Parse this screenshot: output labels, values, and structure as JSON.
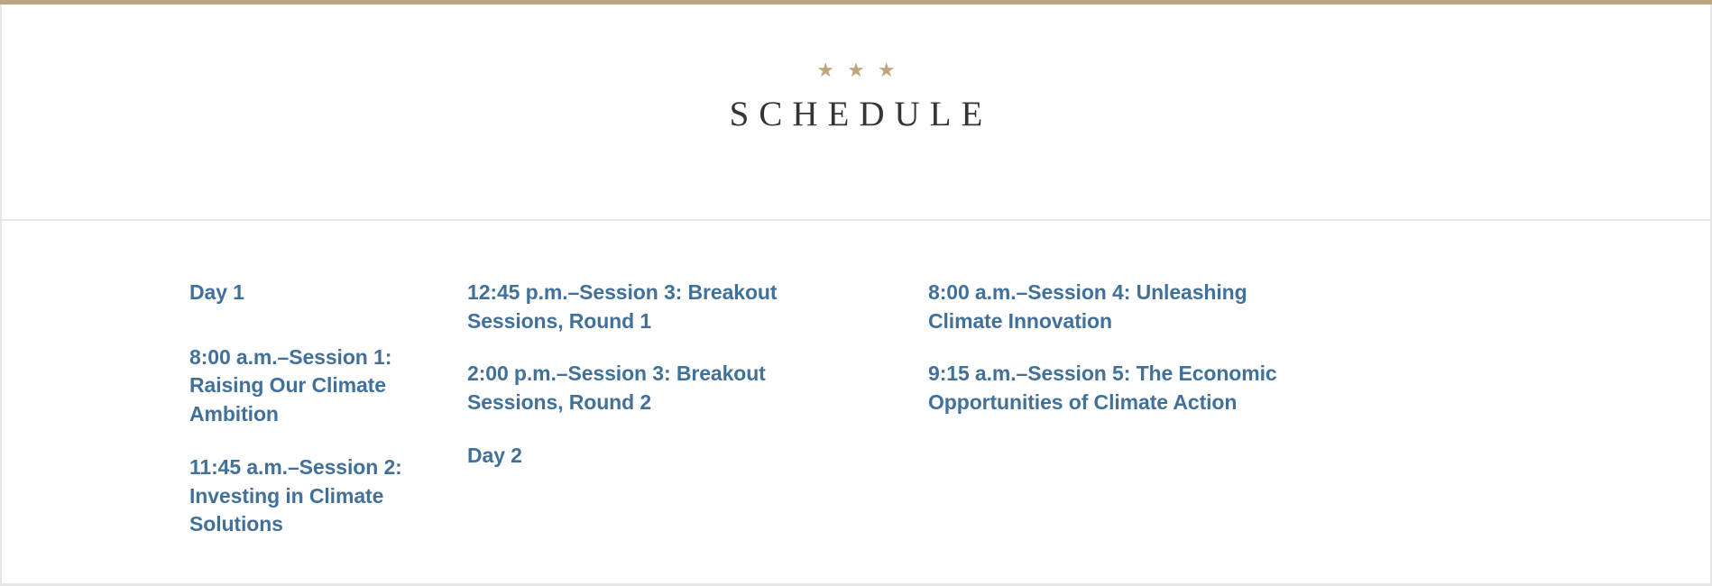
{
  "header": {
    "stars": [
      "★",
      "★",
      "★"
    ],
    "title": "SCHEDULE",
    "star_color": "#bfa57f",
    "title_color": "#33343a",
    "top_rule_color": "#bfa57f"
  },
  "theme": {
    "accent_blue": "#41719b",
    "border_gray": "#e6e6e8",
    "background": "#ffffff"
  },
  "columns": [
    {
      "id": "column-1",
      "items": [
        {
          "type": "day-heading",
          "text": "Day 1"
        },
        {
          "type": "session",
          "text": "8:00 a.m.–Session 1: Raising Our Climate Ambition"
        },
        {
          "type": "session",
          "text": "11:45 a.m.–Session 2: Investing in Climate Solutions"
        }
      ]
    },
    {
      "id": "column-2",
      "items": [
        {
          "type": "session",
          "text": "12:45 p.m.–Session 3: Breakout Sessions, Round 1"
        },
        {
          "type": "session",
          "text": "2:00 p.m.–Session 3: Breakout Sessions, Round 2"
        },
        {
          "type": "day-heading",
          "text": "Day 2"
        }
      ]
    },
    {
      "id": "column-3",
      "items": [
        {
          "type": "session",
          "text": "8:00 a.m.–Session 4: Unleashing Climate Innovation"
        },
        {
          "type": "session",
          "text": "9:15 a.m.–Session 5: The Economic Opportunities of Climate Action"
        }
      ]
    }
  ]
}
